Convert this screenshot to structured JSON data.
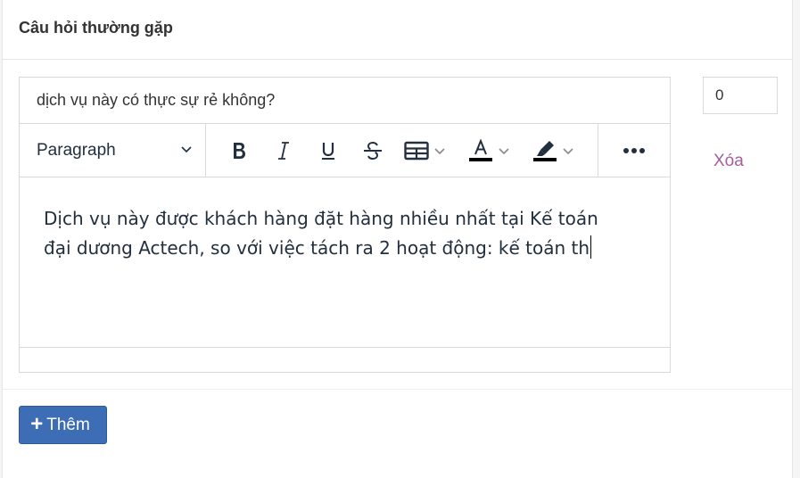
{
  "panel": {
    "title": "Câu hỏi thường gặp"
  },
  "faq_item": {
    "question_value": "dịch vụ này có thực sự rẻ không?",
    "order_value": "0",
    "delete_label": "Xóa",
    "editor": {
      "format_label": "Paragraph",
      "toolbar_icons": [
        "bold-icon",
        "italic-icon",
        "underline-icon",
        "strikethrough-icon",
        "table-icon",
        "text-color-icon",
        "highlight-icon",
        "more-icon"
      ],
      "content_line1": "Dịch vụ này được khách hàng đặt hàng nhiều nhất tại Kế toán",
      "content_line2": "đại dương Actech, so với việc tách ra 2 hoạt động: kế toán th"
    }
  },
  "footer": {
    "add_icon": "+",
    "add_label": "Thêm"
  },
  "colors": {
    "link": "#a65e9d",
    "primary_button": "#3d6eb5",
    "editor_text": "#222f3e"
  }
}
